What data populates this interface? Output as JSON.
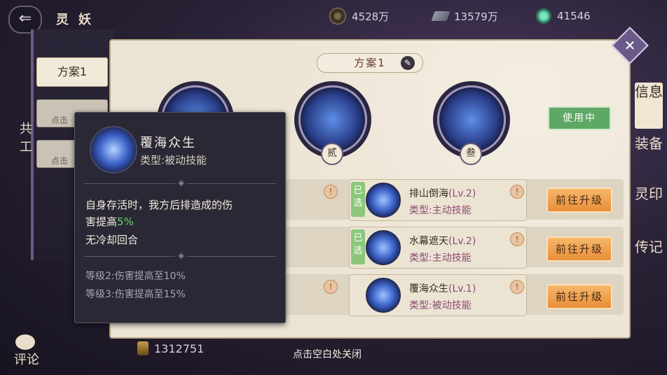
{
  "top_bar": {
    "back_icon": "back-arrow-icon",
    "title": "灵妖",
    "resources": [
      {
        "icon": "coin-icon",
        "value": "4528万"
      },
      {
        "icon": "feather-icon",
        "value": "13579万"
      },
      {
        "icon": "jade-icon",
        "value": "41546"
      }
    ]
  },
  "sidebar": {
    "plan_tab": "方案1",
    "slots": [
      "点击",
      "点击"
    ],
    "side_text_a": "共",
    "side_text_b": "工"
  },
  "panel": {
    "plan_header": "方案1",
    "orb_numbers": [
      "贰",
      "叁"
    ],
    "in_use": "使用中",
    "skills": [
      {
        "name": "排山倒海",
        "level": "(Lv.2)",
        "type": "类型:主动技能",
        "selected": "已选"
      },
      {
        "name": "水幕遮天",
        "level": "(Lv.2)",
        "type": "类型:主动技能",
        "selected": "已选"
      },
      {
        "name": "覆海众生",
        "level": "(Lv.1)",
        "type": "类型:被动技能",
        "selected": ""
      }
    ],
    "upgrade_label": "前往升级",
    "warn_glyph": "!"
  },
  "right_tabs": [
    "信息",
    "装备",
    "灵印",
    "传记"
  ],
  "tooltip": {
    "name": "覆海众生",
    "type": "类型:被动技能",
    "desc_line1": "自身存活时，我方后排造成的伤",
    "desc_line2_prefix": "害提高",
    "desc_highlight": "5%",
    "cooldown": "无冷却回合",
    "level2": "等级2:伤害提高至10%",
    "level3": "等级3:伤害提高至15%"
  },
  "bottom": {
    "currency": "1312751",
    "close_hint": "点击空白处关闭",
    "comment": "评论"
  },
  "colors": {
    "upgrade_button": "#e88e3a",
    "in_use": "#5ea865",
    "highlight": "#6ad06a",
    "skill_type": "#8a4a74"
  }
}
